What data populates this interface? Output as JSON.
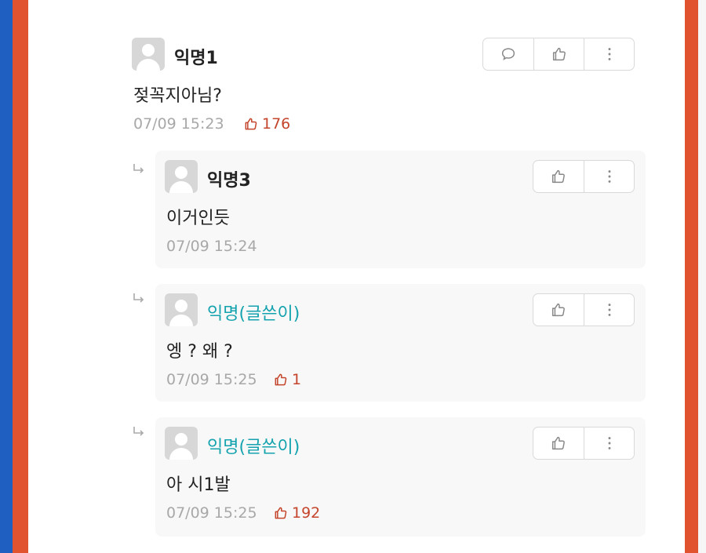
{
  "comments": [
    {
      "name": "익명1",
      "text": "젖꼭지아님?",
      "time": "07/09 15:23",
      "likes": "176"
    },
    {
      "name": "익명3",
      "text": "이거인듯",
      "time": "07/09 15:24",
      "likes": ""
    },
    {
      "name": "익명(글쓴이)",
      "text": "엥 ? 왜 ?",
      "time": "07/09 15:25",
      "likes": "1"
    },
    {
      "name": "익명(글쓴이)",
      "text": "아 시1발",
      "time": "07/09 15:25",
      "likes": "192"
    }
  ],
  "icons": {
    "comment": "speech-bubble-icon",
    "like": "thumbs-up-icon",
    "more": "vertical-dots-icon",
    "reply": "reply-arrow-icon",
    "avatar": "default-avatar-icon"
  },
  "colors": {
    "author_name": "#14a3ae",
    "like_count": "#c4452b",
    "frame_left": "#1f5fc2",
    "frame_border": "#e0532e"
  }
}
